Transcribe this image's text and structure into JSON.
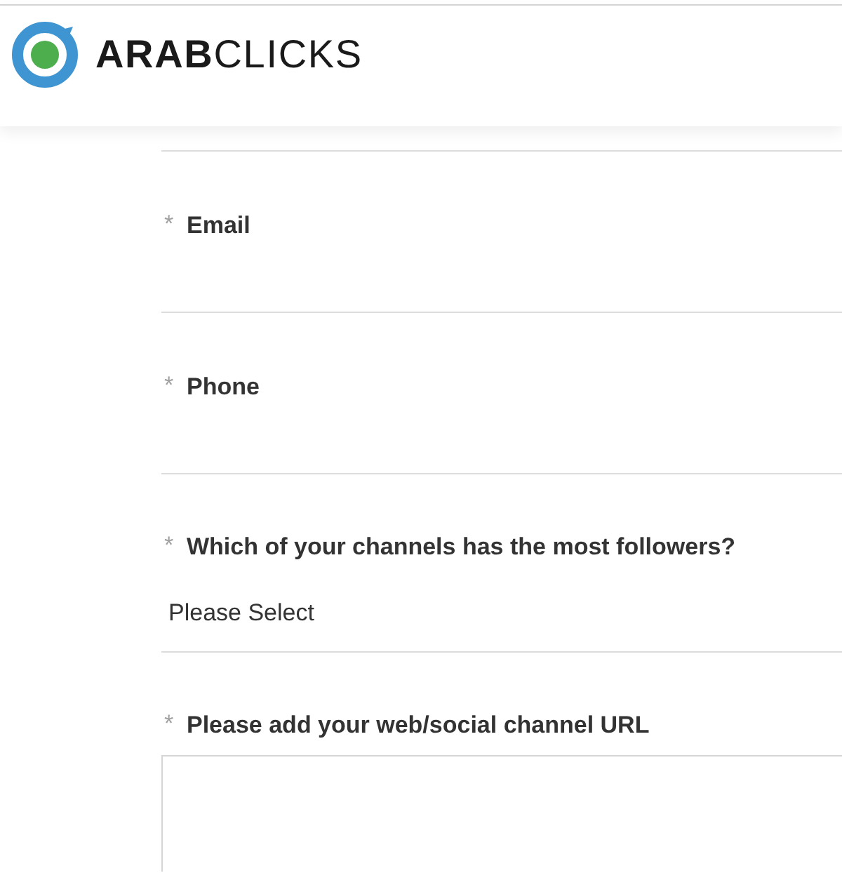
{
  "header": {
    "logo_text": "**ARAB**CLICKS"
  },
  "fields": [
    {
      "kind": "text",
      "marker": "*",
      "label": "Email"
    },
    {
      "kind": "text",
      "marker": "*",
      "label": "Phone"
    },
    {
      "kind": "select",
      "marker": "*",
      "label": "Which of your channels has the most followers?",
      "value": "Please Select"
    },
    {
      "kind": "textarea",
      "marker": "*",
      "label": "Please add your web/social channel URL"
    }
  ]
}
